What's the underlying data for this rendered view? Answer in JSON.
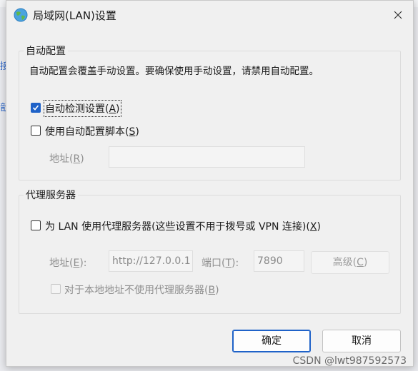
{
  "background": {
    "fragments": [
      "接",
      "戠"
    ]
  },
  "dialog": {
    "title": "局域网(LAN)设置",
    "auto_config": {
      "legend": "自动配置",
      "notice": "自动配置会覆盖手动设置。要确保使用手动设置，请禁用自动配置。",
      "auto_detect": {
        "label": "自动检测设置",
        "accel": "A",
        "checked": true
      },
      "use_script": {
        "label": "使用自动配置脚本",
        "accel": "S",
        "checked": false
      },
      "address": {
        "label": "地址",
        "accel": "R",
        "value": ""
      }
    },
    "proxy": {
      "legend": "代理服务器",
      "use_proxy": {
        "label": "为 LAN 使用代理服务器(这些设置不用于拨号或 VPN 连接)",
        "accel": "X",
        "checked": false
      },
      "address": {
        "label": "地址",
        "accel": "E",
        "suffix": ":",
        "value": "http://127.0.0.1"
      },
      "port": {
        "label": "端口",
        "accel": "T",
        "suffix": ":",
        "value": "7890"
      },
      "advanced_button": {
        "label": "高级",
        "accel": "C"
      },
      "bypass_local": {
        "label": "对于本地地址不使用代理服务器",
        "accel": "B",
        "checked": false
      }
    },
    "buttons": {
      "ok": "确定",
      "cancel": "取消"
    }
  },
  "watermark": "CSDN @lwt987592573",
  "colors": {
    "accent": "#1f62c8",
    "disabled_text": "#8e8e8e",
    "dialog_bg": "#f0f0f0"
  }
}
